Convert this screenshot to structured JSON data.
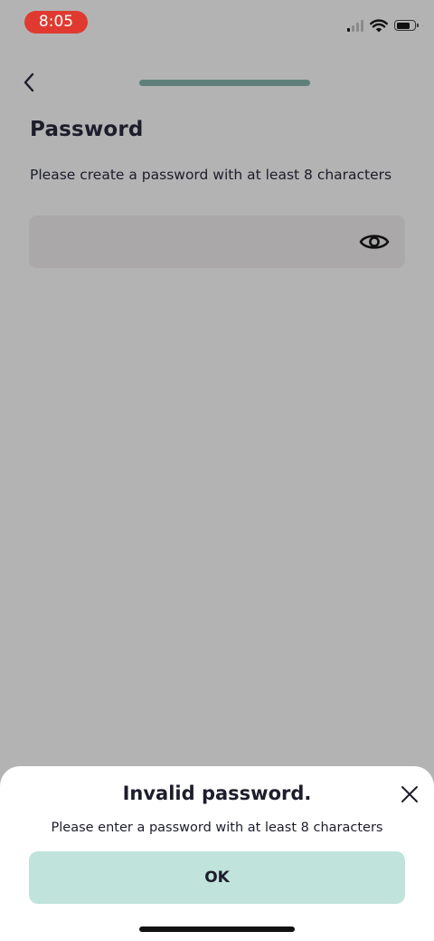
{
  "status_bar": {
    "time": "8:05",
    "signal_icon": "cellular-signal-icon",
    "wifi_icon": "wifi-icon",
    "battery_icon": "battery-icon",
    "time_badge_color": "#e03a30"
  },
  "top_bar": {
    "back_icon": "chevron-left-icon",
    "progress": 1.0,
    "progress_color": "#5f807a"
  },
  "page": {
    "title": "Password",
    "subtitle": "Please create a password with at least 8 characters"
  },
  "password_field": {
    "value": "",
    "placeholder": "",
    "visibility_icon": "eye-icon"
  },
  "dialog": {
    "title": "Invalid password.",
    "message": "Please enter a password with at least 8 characters",
    "ok_label": "OK",
    "close_icon": "close-icon",
    "ok_button_color": "#c0e3db"
  }
}
